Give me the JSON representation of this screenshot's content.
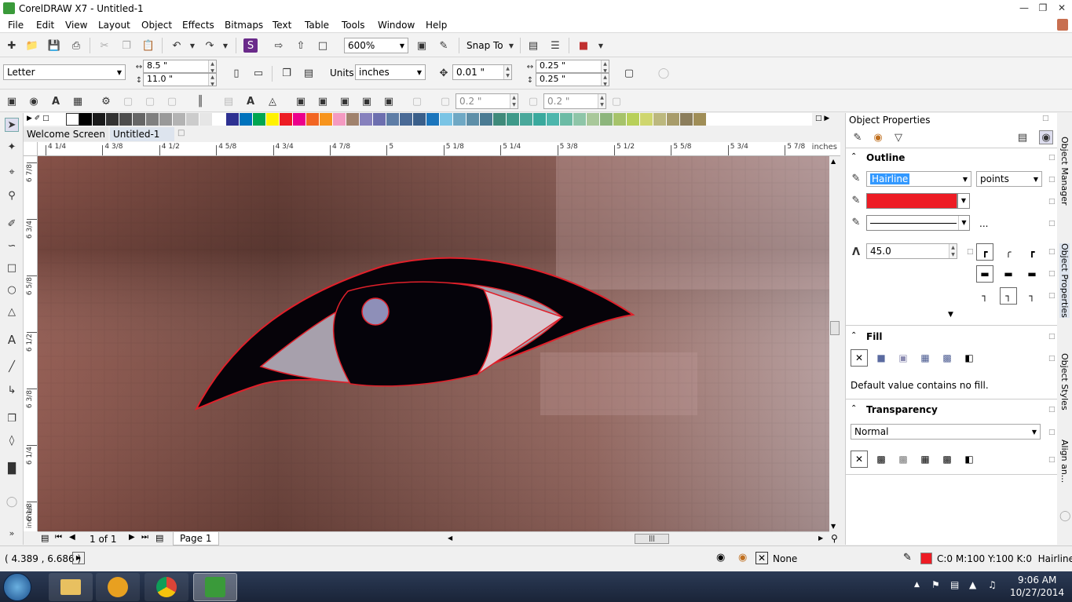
{
  "app": {
    "title": "CorelDRAW X7 - Untitled-1"
  },
  "menu": [
    "File",
    "Edit",
    "View",
    "Layout",
    "Object",
    "Effects",
    "Bitmaps",
    "Text",
    "Table",
    "Tools",
    "Window",
    "Help"
  ],
  "standard_toolbar": {
    "zoom": "600%",
    "snap_to": "Snap To"
  },
  "property_bar": {
    "page_size": "Letter",
    "width": "8.5 \"",
    "height": "11.0 \"",
    "units_label": "Units:",
    "units": "inches",
    "nudge": "0.01 \"",
    "dup_x": "0.25 \"",
    "dup_y": "0.25 \""
  },
  "toolbar3": {
    "val1": "0.2 \"",
    "val2": "0.2 \""
  },
  "palette": [
    "#ffffff",
    "#000000",
    "#1a1a1a",
    "#333333",
    "#4d4d4d",
    "#666666",
    "#808080",
    "#999999",
    "#b3b3b3",
    "#cccccc",
    "#e6e6e6",
    "#ffffff",
    "#2e3192",
    "#0072bc",
    "#00a651",
    "#fff200",
    "#ed1c24",
    "#ec008c",
    "#f26522",
    "#f7941d",
    "#f49ac1",
    "#a0826d",
    "#8781bd",
    "#6d6faf",
    "#5e7da6",
    "#4a6a96",
    "#3a5f8a",
    "#1b75bc",
    "#7ac4e5",
    "#6fa8c4",
    "#5e8fa8",
    "#4b7b93",
    "#3f8a7a",
    "#3f9a8a",
    "#4aa89b",
    "#39a99d",
    "#4db6ac",
    "#6cbba5",
    "#8ec5a8",
    "#a9c89a",
    "#8db57c",
    "#a6c36a",
    "#b8d05a",
    "#cfd66e",
    "#bcb87e",
    "#a89c6b",
    "#8c7e5c",
    "#a08e57"
  ],
  "doc_tabs": {
    "welcome": "Welcome Screen",
    "doc": "Untitled-1"
  },
  "ruler": {
    "h_labels": [
      "4 1/4",
      "4 3/8",
      "4 1/2",
      "4 5/8",
      "4 3/4",
      "4 7/8",
      "5",
      "5 1/8",
      "5 1/4",
      "5 3/8",
      "5 1/2",
      "5 5/8",
      "5 3/4",
      "5 7/8"
    ],
    "v_labels": [
      "6 7/8",
      "6 3/4",
      "6 5/8",
      "6 1/2",
      "6 3/8",
      "6 1/4",
      "6 1/8"
    ],
    "units": "inches"
  },
  "pager": {
    "count": "1 of 1",
    "page": "Page 1"
  },
  "object_properties": {
    "title": "Object Properties",
    "outline": {
      "header": "Outline",
      "width": "Hairline",
      "width_units": "points",
      "color": "#ed1c24",
      "more": "...",
      "miter": "45.0"
    },
    "fill": {
      "header": "Fill",
      "note": "Default value contains no fill."
    },
    "transparency": {
      "header": "Transparency",
      "mode": "Normal"
    }
  },
  "side_tabs": [
    "Object Manager",
    "Object Properties",
    "Object Styles",
    "Align an..."
  ],
  "status": {
    "coords": "( 4.389 , 6.686 )",
    "fill": "None",
    "outline_values": "C:0 M:100 Y:100 K:0  Hairline",
    "outline_color": "#ed1c24"
  },
  "taskbar": {
    "time": "9:06 AM",
    "date": "10/27/2014"
  }
}
